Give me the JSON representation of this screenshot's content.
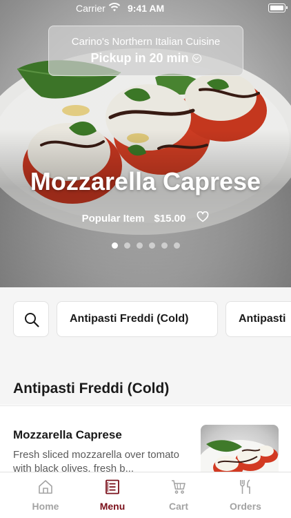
{
  "status_bar": {
    "carrier": "Carrier",
    "time": "9:41 AM"
  },
  "header": {
    "restaurant_name": "Carino's Northern Italian Cuisine",
    "pickup_label": "Pickup in 20 min"
  },
  "hero": {
    "title": "Mozzarella Caprese",
    "tag": "Popular Item",
    "price": "$15.00",
    "slides_count": 6,
    "active_slide": 0
  },
  "categories": {
    "items": [
      "Antipasti Freddi (Cold)",
      "Antipasti"
    ]
  },
  "section": {
    "title": "Antipasti Freddi (Cold)"
  },
  "menu_items": [
    {
      "name": "Mozzarella Caprese",
      "description": "Fresh sliced mozzarella over tomato with black olives, fresh b..."
    }
  ],
  "tabbar": {
    "tabs": [
      {
        "label": "Home",
        "icon": "home-icon"
      },
      {
        "label": "Menu",
        "icon": "menu-icon"
      },
      {
        "label": "Cart",
        "icon": "cart-icon"
      },
      {
        "label": "Orders",
        "icon": "orders-icon"
      }
    ],
    "active": "Menu"
  },
  "colors": {
    "accent": "#7a0f1a",
    "tab_inactive": "#a3a3a3",
    "strip_bg": "#f5f5f5"
  }
}
